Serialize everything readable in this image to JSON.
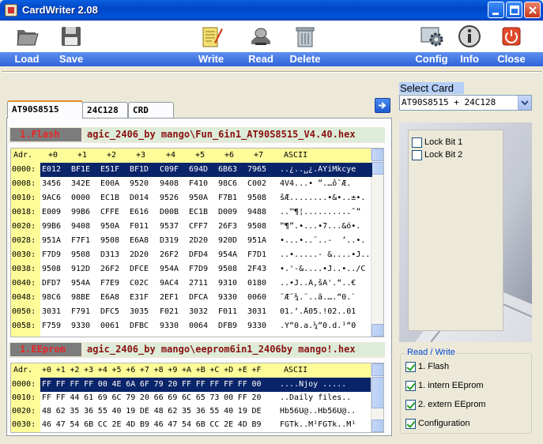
{
  "window": {
    "title": "CardWriter 2.08",
    "icon": "card-icon"
  },
  "toolbar": {
    "load": "Load",
    "save": "Save",
    "write": "Write",
    "read": "Read",
    "delete": "Delete",
    "config": "Config",
    "info": "Info",
    "close": "Close"
  },
  "tabs": [
    "AT90S8515",
    "24C128",
    "CRD"
  ],
  "flash": {
    "section": "1.Flash",
    "path": "agic_2406_by mango\\Fun_6in1_AT90S8515_V4.40.hex",
    "headers": [
      "Adr.",
      "+0",
      "+1",
      "+2",
      "+3",
      "+4",
      "+5",
      "+6",
      "+7",
      "ASCII"
    ],
    "rows": [
      {
        "addr": "0000:",
        "cells": [
          "E012",
          "BF1E",
          "E51F",
          "BF1D",
          "C09F",
          "694D",
          "6B63",
          "7965"
        ],
        "ascii": "..¿..␣¿.ÀŸiMkcye"
      },
      {
        "addr": "0008:",
        "cells": [
          "3456",
          "342E",
          "E00A",
          "9520",
          "9408",
          "F410",
          "98C6",
          "C002"
        ],
        "ascii": "4V4...• ”.…ô˜Æ."
      },
      {
        "addr": "0010:",
        "cells": [
          "9AC6",
          "0000",
          "EC1B",
          "D014",
          "9526",
          "950A",
          "F7B1",
          "9508"
        ],
        "ascii": "šÆ........•&•..±•."
      },
      {
        "addr": "0018:",
        "cells": [
          "E009",
          "99B6",
          "CFFE",
          "E616",
          "D00B",
          "EC1B",
          "D009",
          "9488"
        ],
        "ascii": "..™¶¦..........ˆ”"
      },
      {
        "addr": "0020:",
        "cells": [
          "99B6",
          "9408",
          "950A",
          "F011",
          "9537",
          "CFF7",
          "26F3",
          "9508"
        ],
        "ascii": "™¶”.•...•7...&ó•."
      },
      {
        "addr": "0028:",
        "cells": [
          "951A",
          "F7F1",
          "9508",
          "E6A8",
          "D319",
          "2D20",
          "920D",
          "951A"
        ],
        "ascii": "•...•..¨..-  ’..•."
      },
      {
        "addr": "0030:",
        "cells": [
          "F7D9",
          "9508",
          "D313",
          "2D20",
          "26F2",
          "DFD4",
          "954A",
          "F7D1"
        ],
        "ascii": "..•.....- &....•J.."
      },
      {
        "addr": "0038:",
        "cells": [
          "9508",
          "912D",
          "26F2",
          "DFCE",
          "954A",
          "F7D9",
          "9508",
          "2F43"
        ],
        "ascii": "•.'-&....•J..•../C"
      },
      {
        "addr": "0040:",
        "cells": [
          "DFD7",
          "954A",
          "F7E9",
          "C02C",
          "9AC4",
          "2711",
          "9310",
          "0180"
        ],
        "ascii": "..•J..À,šÄ'.“..€"
      },
      {
        "addr": "0048:",
        "cells": [
          "98C6",
          "98BE",
          "E6A8",
          "E31F",
          "2EF1",
          "DFCA",
          "9330",
          "0060"
        ],
        "ascii": "˜Æ˜¾.¨..ã.….“0.`"
      },
      {
        "addr": "0050:",
        "cells": [
          "3031",
          "F791",
          "DFC5",
          "3035",
          "F021",
          "3032",
          "F011",
          "3031"
        ],
        "ascii": "01.‘.Å05.!02..01"
      },
      {
        "addr": "0058:",
        "cells": [
          "F759",
          "9330",
          "0061",
          "DFBC",
          "9330",
          "0064",
          "DFB9",
          "9330"
        ],
        "ascii": ".Y“0.a.¼“0.d.¹“0"
      }
    ]
  },
  "eeprom": {
    "section": "1.EEprom",
    "path": "agic_2406_by mango\\eeprom6in1_2406by mango!.hex",
    "headers": [
      "Adr.",
      "+0",
      "+1",
      "+2",
      "+3",
      "+4",
      "+5",
      "+6",
      "+7",
      "+8",
      "+9",
      "+A",
      "+B",
      "+C",
      "+D",
      "+E",
      "+F",
      "ASCII"
    ],
    "rows": [
      {
        "addr": "0000:",
        "cells": [
          "FF",
          "FF",
          "FF",
          "FF",
          "00",
          "4E",
          "6A",
          "6F",
          "79",
          "20",
          "FF",
          "FF",
          "FF",
          "FF",
          "FF",
          "00"
        ],
        "ascii": "....Njoy ....."
      },
      {
        "addr": "0010:",
        "cells": [
          "FF",
          "FF",
          "44",
          "61",
          "69",
          "6C",
          "79",
          "20",
          "66",
          "69",
          "6C",
          "65",
          "73",
          "00",
          "FF",
          "20"
        ],
        "ascii": "..Daily files.."
      },
      {
        "addr": "0020:",
        "cells": [
          "48",
          "62",
          "35",
          "36",
          "55",
          "40",
          "19",
          "DE",
          "48",
          "62",
          "35",
          "36",
          "55",
          "40",
          "19",
          "DE"
        ],
        "ascii": "Hb56U@..Hb56U@.."
      },
      {
        "addr": "0030:",
        "cells": [
          "46",
          "47",
          "54",
          "6B",
          "CC",
          "2E",
          "4D",
          "B9",
          "46",
          "47",
          "54",
          "6B",
          "CC",
          "2E",
          "4D",
          "B9"
        ],
        "ascii": "FGTk..M¹FGTk..M¹"
      }
    ]
  },
  "select_card": {
    "label": "Select Card",
    "value": "AT90S8515 + 24C128"
  },
  "lock_bits": [
    {
      "label": "Lock Bit 1",
      "checked": false
    },
    {
      "label": "Lock Bit 2",
      "checked": false
    }
  ],
  "read_write": {
    "legend": "Read / Write",
    "items": [
      {
        "label": "1. Flash",
        "checked": true
      },
      {
        "label": "1. intern EEprom",
        "checked": true
      },
      {
        "label": "2. extern EEprom",
        "checked": true
      },
      {
        "label": "Configuration",
        "checked": true
      }
    ]
  },
  "colors": {
    "title_bar": "#0047c8",
    "toolbar_strip": "#3d6fe0",
    "address_column": "#fdfc98",
    "selection": "#0a246a",
    "path_text": "#8a1010",
    "check_mark": "#21a121"
  }
}
